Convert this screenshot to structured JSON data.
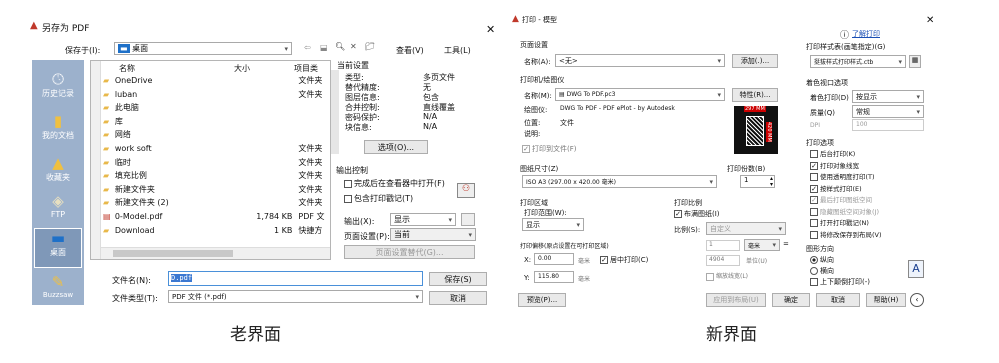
{
  "old": {
    "title": "另存为 PDF",
    "save_in_label": "保存于(I):",
    "save_in_value": "桌面",
    "view_label": "查看(V)",
    "tools_label": "工具(L)",
    "places": [
      "历史记录",
      "我的文档",
      "收藏夹",
      "FTP",
      "桌面",
      "Buzzsaw"
    ],
    "col_name": "名称",
    "col_size": "大小",
    "col_type": "项目类",
    "files": [
      {
        "name": "OneDrive",
        "size": "",
        "type": "文件夹"
      },
      {
        "name": "luban",
        "size": "",
        "type": "文件夹"
      },
      {
        "name": "此电脑",
        "size": "",
        "type": ""
      },
      {
        "name": "库",
        "size": "",
        "type": ""
      },
      {
        "name": "网络",
        "size": "",
        "type": ""
      },
      {
        "name": "work soft",
        "size": "",
        "type": "文件夹"
      },
      {
        "name": "临时",
        "size": "",
        "type": "文件夹"
      },
      {
        "name": "填充比例",
        "size": "",
        "type": "文件夹"
      },
      {
        "name": "新建文件夹",
        "size": "",
        "type": "文件夹"
      },
      {
        "name": "新建文件夹 (2)",
        "size": "",
        "type": "文件夹"
      },
      {
        "name": "0-Model.pdf",
        "size": "1,784 KB",
        "type": "PDF 文"
      },
      {
        "name": "Download",
        "size": "1 KB",
        "type": "快捷方"
      }
    ],
    "current_settings_title": "当前设置",
    "settings": [
      {
        "k": "类型:",
        "v": "多页文件"
      },
      {
        "k": "替代精度:",
        "v": "无"
      },
      {
        "k": "图层信息:",
        "v": "包含"
      },
      {
        "k": "合并控制:",
        "v": "直线覆盖"
      },
      {
        "k": "密码保护:",
        "v": "N/A"
      },
      {
        "k": "块信息:",
        "v": "N/A"
      }
    ],
    "options_btn": "选项(O)...",
    "output_control_title": "输出控制",
    "open_in_viewer": "完成后在查看器中打开(F)",
    "include_stamp": "包含打印戳记(T)",
    "output_label": "输出(X):",
    "output_value": "显示",
    "page_setup_label": "页面设置(P):",
    "page_setup_value": "当前",
    "override_btn": "页面设置替代(G)...",
    "filename_label": "文件名(N):",
    "filename_value": "D.pdf",
    "filetype_label": "文件类型(T):",
    "filetype_value": "PDF 文件 (*.pdf)",
    "save_btn": "保存(S)",
    "cancel_btn": "取消"
  },
  "new": {
    "title": "打印 - 模型",
    "help_link": "了解打印",
    "page_setup_title": "页面设置",
    "name_label": "名称(A):",
    "name_value": "<无>",
    "add_btn": "添加(.)...",
    "printer_title": "打印机/绘图仪",
    "printer_name_label": "名称(M):",
    "printer_name_value": "DWG To PDF.pc3",
    "properties_btn": "特性(R)...",
    "plotter_label": "绘图仪:",
    "plotter_value": "DWG To PDF - PDF ePlot - by Autodesk",
    "location_label": "位置:",
    "location_value": "文件",
    "desc_label": "说明:",
    "plot_to_file": "打印到文件(F)",
    "preview_width": "297 MM",
    "preview_height": "420 MM",
    "paper_size_title": "图纸尺寸(Z)",
    "paper_size_value": "ISO A3 (297.00 x 420.00 毫米)",
    "copies_title": "打印份数(B)",
    "copies_value": "1",
    "plot_area_title": "打印区域",
    "plot_range_label": "打印范围(W):",
    "plot_range_value": "显示",
    "plot_scale_title": "打印比例",
    "fit_paper": "布满图纸(I)",
    "scale_label": "比例(S):",
    "scale_value": "自定义",
    "unit1": "1",
    "unit_mm": "毫米",
    "unit2": "4904",
    "unit_label": "单位(U)",
    "scale_lineweight": "缩放线宽(L)",
    "offset_title": "打印偏移(原点设置在可打印区域)",
    "x_label": "X:",
    "x_value": "0.00",
    "y_label": "Y:",
    "y_value": "115.80",
    "mm": "毫米",
    "center_plot": "居中打印(C)",
    "style_table_title": "打印样式表(画笔指定)(G)",
    "style_table_value": "挺拔样式打印样式.ctb",
    "viewport_title": "着色视口选项",
    "shade_label": "着色打印(D)",
    "shade_value": "按显示",
    "quality_label": "质量(Q)",
    "quality_value": "常规",
    "dpi_label": "DPI",
    "dpi_value": "100",
    "plot_options_title": "打印选项",
    "options": [
      {
        "label": "后台打印(K)",
        "checked": false
      },
      {
        "label": "打印对象线宽",
        "checked": true
      },
      {
        "label": "使用透明度打印(T)",
        "checked": false
      },
      {
        "label": "按样式打印(E)",
        "checked": true
      },
      {
        "label": "最后打印图纸空间",
        "checked": true
      },
      {
        "label": "隐藏图纸空间对象(J)",
        "checked": false
      },
      {
        "label": "打开打印戳记(N)",
        "checked": false
      },
      {
        "label": "将修改保存到布局(V)",
        "checked": false
      }
    ],
    "orientation_title": "图形方向",
    "portrait": "纵向",
    "landscape": "横向",
    "upside_down": "上下颠倒打印(-)",
    "preview_btn": "预览(P)...",
    "apply_layout_btn": "应用到布局(U)",
    "ok_btn": "确定",
    "cancel_btn": "取消",
    "help_btn": "帮助(H)"
  },
  "captions": {
    "old": "老界面",
    "new": "新界面"
  }
}
